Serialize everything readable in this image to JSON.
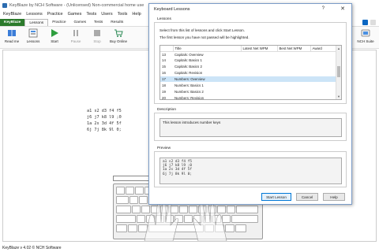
{
  "window": {
    "title": "KeyBlaze by NCH Software - (Unlicensed) Non-commercial home use",
    "menu": [
      "KeyBlaze",
      "Lessons",
      "Practice",
      "Games",
      "Tests",
      "Users",
      "Tools",
      "Help"
    ],
    "tabs": [
      "KeyBlaze",
      "Lessons",
      "Practice",
      "Games",
      "Tests",
      "Results"
    ]
  },
  "toolbar": {
    "read_me": "Read me",
    "lessons": "Lessons",
    "start": "Start",
    "pause": "Pause",
    "stop": "Stop",
    "buy_online": "Buy Online",
    "nch_suite": "NCH Suite"
  },
  "practice_text": "a1 s2 d3 f4 f5\nj6 j7 k8 l9 ;0\n1a 2s 3d 4f 5f\n6j 7j 8k 9l 0;",
  "status": "KeyBlaze v 4.02 © NCH Software",
  "dialog": {
    "title": "Keyboard Lessons",
    "help_glyph": "?",
    "close_glyph": "✕",
    "lessons_group": "Lessons",
    "instruction1": "Select from this list of lessons and click Start Lesson.",
    "instruction2": "The first lesson you have not passed will be highlighted.",
    "columns": [
      "",
      "Title",
      "Latest Net WPM",
      "Best Net WPM",
      "Award"
    ],
    "rows": [
      {
        "num": "13",
        "title": "Capitals: Overview"
      },
      {
        "num": "14",
        "title": "Capitals: Basics 1"
      },
      {
        "num": "15",
        "title": "Capitals: Basics 2"
      },
      {
        "num": "16",
        "title": "Capitals: Revision"
      },
      {
        "num": "17",
        "title": "Numbers: Overview",
        "selected": true
      },
      {
        "num": "18",
        "title": "Numbers: Basics 1"
      },
      {
        "num": "19",
        "title": "Numbers: Basics 2"
      },
      {
        "num": "20",
        "title": "Numbers: Revision"
      }
    ],
    "description_label": "Description",
    "description": "This lesson introduces number keys",
    "preview_label": "Preview",
    "preview": "a1 s2 d3 f4 f5\nj6 j7 k8 l9 ;0\n1a 2s 3d 4f 5f\n6j 7j 8k 9l 0;",
    "start_button": "Start Lesson",
    "cancel_button": "Cancel",
    "help_button": "Help"
  },
  "colors": {
    "brand": "#2b7a2b",
    "selection": "#cce4f7",
    "dialog_border": "#7a9cc8"
  }
}
